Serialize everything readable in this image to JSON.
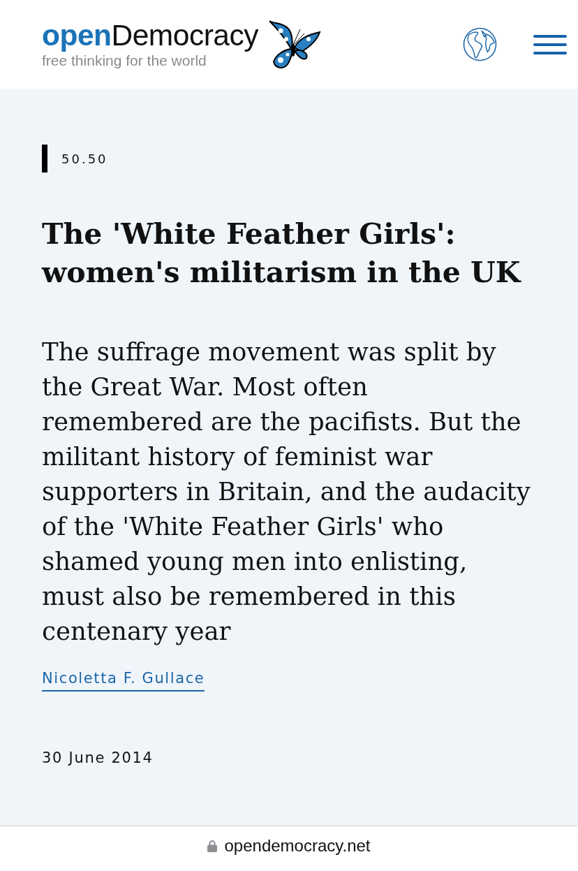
{
  "header": {
    "logo": "**open**Democracy",
    "tagline": "free thinking for the world"
  },
  "article": {
    "section": "50.50",
    "title": "The 'White Feather Girls': women's militarism in the UK",
    "standfirst": "The suffrage movement was split by the Great War. Most often remembered are the pacifists. But the militant history of feminist war supporters in Britain, and the audacity of the 'White Feather Girls' who shamed young men into enlisting, must also be remembered in this centenary year",
    "author": "Nicoletta F. Gullace",
    "date": "30 June 2014"
  },
  "address_bar": {
    "url": "opendemocracy.net"
  }
}
